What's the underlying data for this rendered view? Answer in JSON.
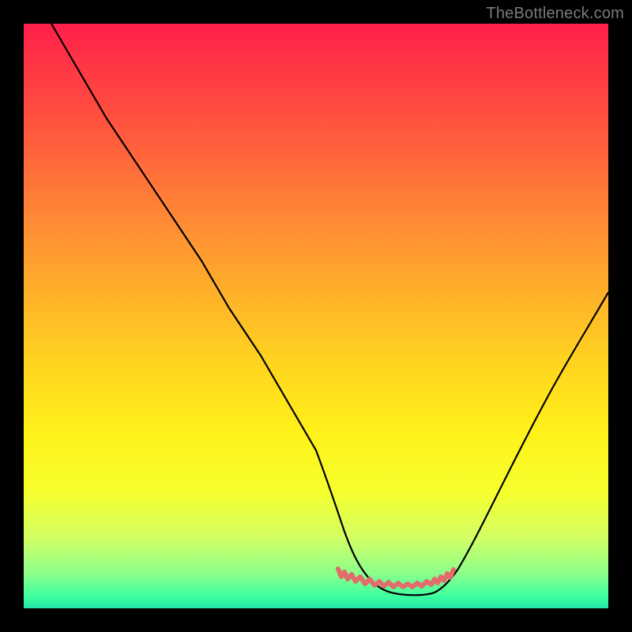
{
  "watermark": "TheBottleneck.com",
  "colors": {
    "line_main": "#000000",
    "line_bottom_accent": "#e36b6b",
    "background": "#000000"
  },
  "chart_data": {
    "type": "line",
    "title": "",
    "xlabel": "",
    "ylabel": "",
    "xlim": [
      0,
      100
    ],
    "ylim": [
      0,
      100
    ],
    "x": [
      0,
      5,
      10,
      15,
      20,
      25,
      30,
      35,
      40,
      45,
      50,
      52,
      55,
      58,
      60,
      62,
      65,
      68,
      70,
      75,
      80,
      85,
      90,
      95,
      100
    ],
    "values": [
      100,
      92,
      84,
      76,
      68,
      60,
      52,
      44,
      36,
      28,
      16,
      10,
      6,
      3,
      2,
      2,
      2,
      3,
      6,
      14,
      24,
      34,
      42,
      49,
      55
    ],
    "series": [
      {
        "name": "bottleneck-curve",
        "color": "#000000",
        "x": [
          0,
          5,
          10,
          15,
          20,
          25,
          30,
          35,
          40,
          45,
          50,
          52,
          55,
          58,
          60,
          62,
          65,
          68,
          70,
          75,
          80,
          85,
          90,
          95,
          100
        ],
        "values": [
          100,
          92,
          84,
          76,
          68,
          60,
          52,
          44,
          36,
          28,
          16,
          10,
          6,
          3,
          2,
          2,
          2,
          3,
          6,
          14,
          24,
          34,
          42,
          49,
          55
        ]
      },
      {
        "name": "optimal-zone-marker",
        "color": "#e36b6b",
        "x": [
          52,
          55,
          58,
          60,
          62,
          65,
          68
        ],
        "values": [
          4,
          3,
          2,
          2,
          2,
          2,
          3
        ]
      }
    ]
  }
}
